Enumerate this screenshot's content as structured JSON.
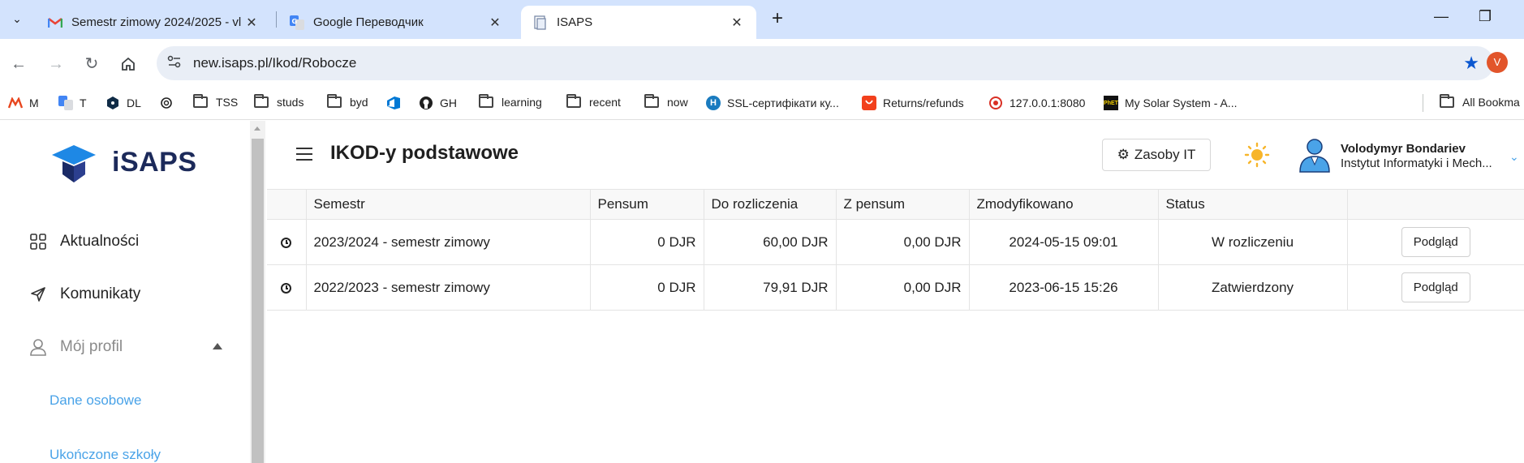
{
  "browser": {
    "tabs": [
      {
        "title": "Semestr zimowy 2024/2025 - vl",
        "favicon": "gmail-icon",
        "active": false
      },
      {
        "title": "Google Переводчик",
        "favicon": "google-translate-icon",
        "active": false
      },
      {
        "title": "ISAPS",
        "favicon": "document-icon",
        "active": true
      }
    ],
    "url": "new.isaps.pl/Ikod/Robocze",
    "profile_initial": "V",
    "bookmarks": [
      {
        "label": "M",
        "icon": "aliexpress-icon"
      },
      {
        "label": "T",
        "icon": "translate-icon"
      },
      {
        "label": "DL",
        "icon": "deepl-icon"
      },
      {
        "label": "",
        "icon": "openai-icon"
      },
      {
        "label": "TSS",
        "icon": "folder-icon"
      },
      {
        "label": "studs",
        "icon": "folder-icon"
      },
      {
        "label": "byd",
        "icon": "folder-icon"
      },
      {
        "label": "",
        "icon": "azure-devops-icon"
      },
      {
        "label": "GH",
        "icon": "github-icon"
      },
      {
        "label": "learning",
        "icon": "folder-icon"
      },
      {
        "label": "recent",
        "icon": "folder-icon"
      },
      {
        "label": "now",
        "icon": "folder-icon"
      },
      {
        "label": "SSL-сертифікати ку...",
        "icon": "h-icon"
      },
      {
        "label": "Returns/refunds",
        "icon": "aliexpress-bag-icon"
      },
      {
        "label": "127.0.0.1:8080",
        "icon": "localhost-icon"
      },
      {
        "label": "My Solar System - A...",
        "icon": "phet-icon"
      },
      {
        "label": "All Bookma",
        "icon": "folder-icon"
      }
    ]
  },
  "app": {
    "logo_text": "iSAPS",
    "sidebar": {
      "items": [
        {
          "label": "Aktualności",
          "icon": "grid-icon"
        },
        {
          "label": "Komunikaty",
          "icon": "send-icon"
        },
        {
          "label": "Mój profil",
          "icon": "user-icon"
        }
      ],
      "submenu": [
        "Dane osobowe",
        "Ukończone szkoły"
      ]
    },
    "header": {
      "title": "IKOD-y podstawowe",
      "zasoby_label": "Zasoby IT",
      "user_name": "Volodymyr Bondariev",
      "user_institute": "Instytut Informatyki i Mech..."
    },
    "table": {
      "columns": [
        "",
        "Semestr",
        "Pensum",
        "Do rozliczenia",
        "Z pensum",
        "Zmodyfikowano",
        "Status",
        ""
      ],
      "rows": [
        {
          "semestr": "2023/2024 - semestr zimowy",
          "pensum": "0 DJR",
          "do_rozliczenia": "60,00 DJR",
          "z_pensum": "0,00 DJR",
          "zmodyfikowano": "2024-05-15 09:01",
          "status": "W rozliczeniu",
          "action": "Podgląd"
        },
        {
          "semestr": "2022/2023 - semestr zimowy",
          "pensum": "0 DJR",
          "do_rozliczenia": "79,91 DJR",
          "z_pensum": "0,00 DJR",
          "zmodyfikowano": "2023-06-15 15:26",
          "status": "Zatwierdzony",
          "action": "Podgląd"
        }
      ]
    }
  }
}
